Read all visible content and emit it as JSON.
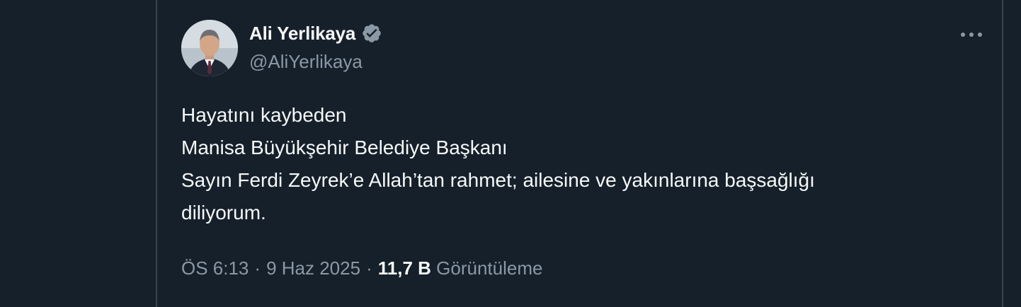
{
  "author": {
    "display_name": "Ali Yerlikaya",
    "handle": "@AliYerlikaya",
    "verified_icon": "verified-badge-icon",
    "verified_color": "#8b98a5"
  },
  "more_icon": "more-horizontal-icon",
  "tweet": {
    "lines": [
      "Hayatını kaybeden",
      "Manisa Büyükşehir Belediye Başkanı",
      "Sayın Ferdi Zeyrek’e Allah’tan rahmet; ailesine ve yakınlarına başsağlığı",
      "diliyorum."
    ]
  },
  "meta": {
    "time": "ÖS 6:13",
    "separator": "·",
    "date": "9 Haz 2025",
    "views_count": "11,7 B",
    "views_label": "Görüntüleme"
  },
  "colors": {
    "background": "#15202b",
    "border": "#38444d",
    "text_primary": "#f7f9f9",
    "text_secondary": "#8b98a5"
  }
}
